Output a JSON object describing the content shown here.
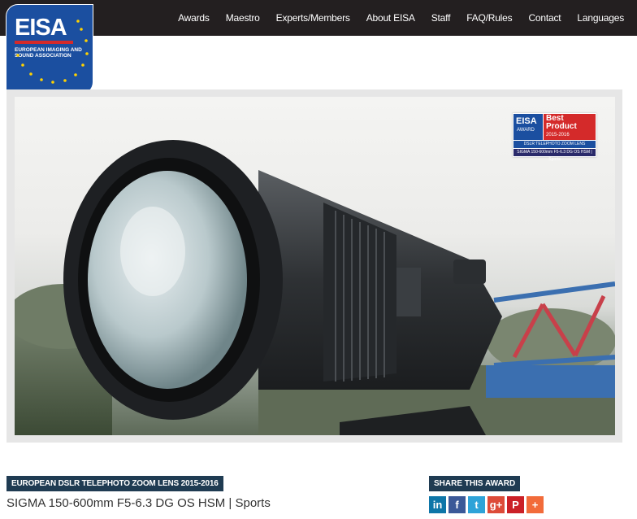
{
  "logo": {
    "wordmark": "EISA",
    "subtitle_line1": "EUROPEAN IMAGING AND",
    "subtitle_line2": "SOUND ASSOCIATION"
  },
  "nav": {
    "items": [
      "Awards",
      "Maestro",
      "Experts/Members",
      "About EISA",
      "Staff",
      "FAQ/Rules",
      "Contact",
      "Languages"
    ]
  },
  "badge": {
    "eisa": "EISA",
    "award": "AWARD",
    "best_line1": "Best",
    "best_line2": "Product",
    "years": "2015-2016",
    "category": "DSLR TELEPHOTO ZOOM LENS",
    "product": "SIGMA 150-600mm F5-6.3 DG OS HSM | Sports"
  },
  "award": {
    "category_label": "EUROPEAN DSLR TELEPHOTO ZOOM LENS 2015-2016",
    "product_name": "SIGMA 150-600mm F5-6.3 DG OS HSM | Sports"
  },
  "share": {
    "label": "SHARE THIS AWARD",
    "icons": [
      {
        "name": "linkedin-icon",
        "glyph": "in",
        "color": "#0e76a8"
      },
      {
        "name": "facebook-icon",
        "glyph": "f",
        "color": "#3b5998"
      },
      {
        "name": "twitter-icon",
        "glyph": "t",
        "color": "#2ea3d8"
      },
      {
        "name": "googleplus-icon",
        "glyph": "g+",
        "color": "#dd4b39"
      },
      {
        "name": "pinterest-icon",
        "glyph": "P",
        "color": "#cb2027"
      },
      {
        "name": "more-icon",
        "glyph": "+",
        "color": "#f26b3a"
      }
    ]
  },
  "colors": {
    "topbar": "#231f20",
    "logo_blue": "#1b4fa0",
    "accent_red": "#d42a2a",
    "label_bg": "#1f3b52"
  }
}
